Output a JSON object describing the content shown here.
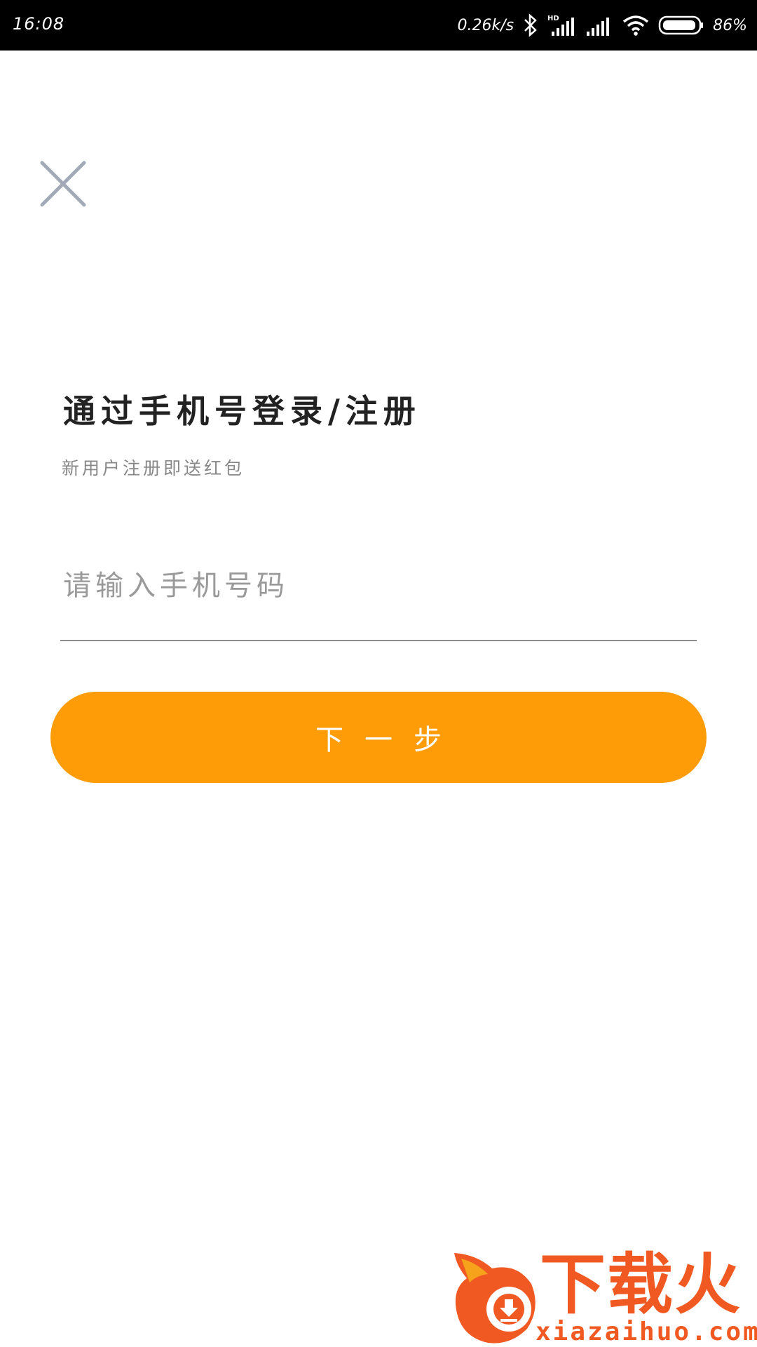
{
  "status_bar": {
    "time": "16:08",
    "network_speed": "0.26k/s",
    "battery_percent": "86%",
    "icons": [
      "bluetooth-icon",
      "hd-signal-icon",
      "signal-icon",
      "wifi-icon",
      "battery-icon"
    ]
  },
  "close_button": {
    "icon": "close-icon"
  },
  "header": {
    "title": "通过手机号登录/注册",
    "subtitle": "新用户注册即送红包"
  },
  "phone_input": {
    "placeholder": "请输入手机号码",
    "value": ""
  },
  "next_button": {
    "label": "下一步",
    "color": "#fd9c07"
  },
  "watermark": {
    "title": "下载火",
    "url": "xiazaihuo.com",
    "color": "#f05a22"
  }
}
